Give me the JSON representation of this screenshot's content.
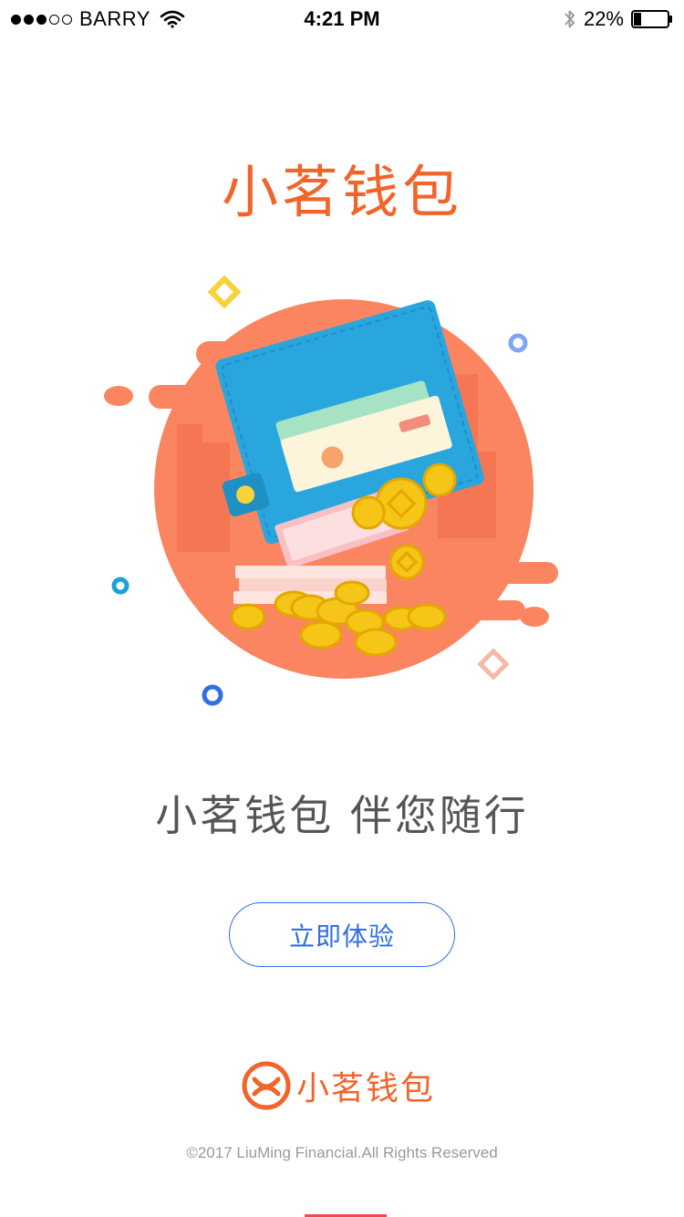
{
  "status_bar": {
    "carrier": "BARRY",
    "time": "4:21 PM",
    "battery_percent": "22%",
    "signal_bars_filled": 3,
    "signal_bars_total": 5,
    "battery_level": 0.22
  },
  "header": {
    "title": "小茗钱包"
  },
  "hero": {
    "icons": [
      "wallet-illustration",
      "coin-icon",
      "banknote-icon"
    ]
  },
  "main": {
    "slogan": "小茗钱包 伴您随行",
    "cta_label": "立即体验"
  },
  "footer": {
    "brand": "小茗钱包",
    "copyright": "©2017 LiuMing Financial.All Rights Reserved"
  },
  "colors": {
    "brand_orange": "#f2642a",
    "cta_blue": "#2f6fe0",
    "text_gray": "#555555",
    "muted_gray": "#9a9a9a"
  }
}
